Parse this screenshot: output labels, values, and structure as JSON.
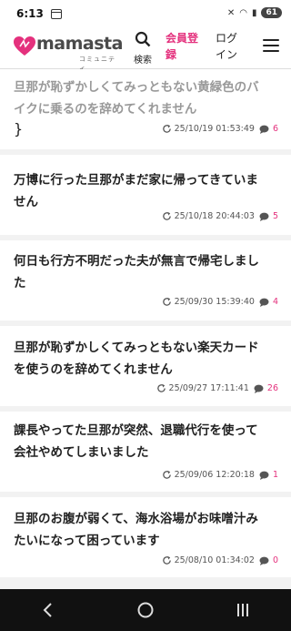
{
  "status": {
    "time": "6:13",
    "battery": "61"
  },
  "header": {
    "logo_text": "mamasta",
    "logo_sub": "コミュニティ",
    "search_label": "検索",
    "register_line1": "会員登",
    "register_line2": "録",
    "login_line1": "ログ",
    "login_line2": "イン"
  },
  "posts": [
    {
      "title_line1": "旦那が恥ずかしくてみっともない黄緑色のバ",
      "title_line2": "イクに乗るのを辞めてくれません",
      "date": "25/10/19 01:53:49",
      "comments": "6"
    },
    {
      "title_line1": "万博に行った旦那がまだ家に帰ってきていま",
      "title_line2": "せん",
      "date": "25/10/18 20:44:03",
      "comments": "5"
    },
    {
      "title_line1": "何日も行方不明だった夫が無言で帰宅しまし",
      "title_line2": "た",
      "date": "25/09/30 15:39:40",
      "comments": "4"
    },
    {
      "title_line1": "旦那が恥ずかしくてみっともない楽天カード",
      "title_line2": "を使うのを辞めてくれません",
      "date": "25/09/27 17:11:41",
      "comments": "26"
    },
    {
      "title_line1": "課長やってた旦那が突然、退職代行を使って",
      "title_line2": "会社やめてしまいました",
      "date": "25/09/06 12:20:18",
      "comments": "1"
    },
    {
      "title_line1": "旦那のお腹が弱くて、海水浴場がお味噌汁み",
      "title_line2": "たいになって困っています",
      "date": "25/08/10 01:34:02",
      "comments": "0"
    }
  ],
  "colors": {
    "accent": "#e4317d",
    "text": "#222222",
    "background": "#f2f2f2"
  }
}
